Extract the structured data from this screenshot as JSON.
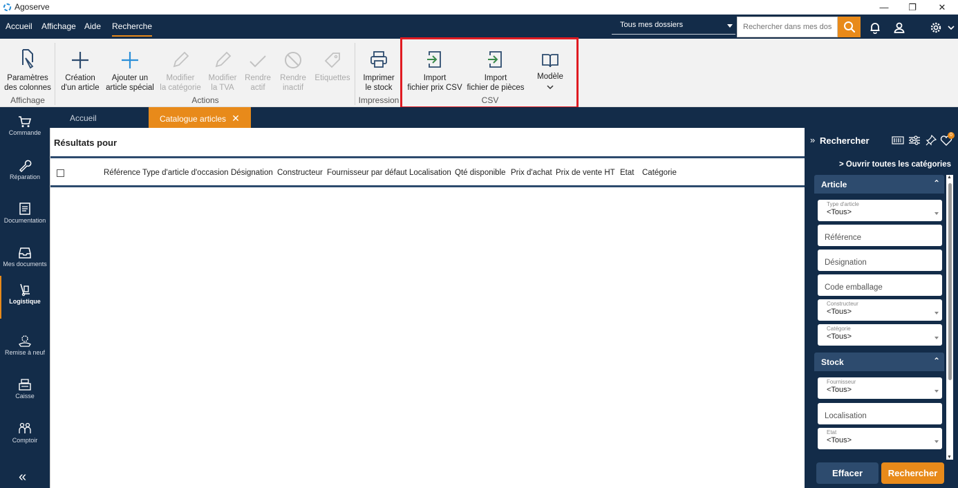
{
  "window": {
    "title": "Agoserve",
    "min": "—",
    "restore": "❐",
    "close": "✕"
  },
  "menu": {
    "items": [
      "Accueil",
      "Affichage",
      "Aide",
      "Recherche"
    ],
    "active": "Recherche"
  },
  "header": {
    "dossier_select": "Tous mes dossiers",
    "search_placeholder": "Rechercher dans mes dossiers"
  },
  "ribbon": {
    "buttons": {
      "col_params": [
        "Paramètres",
        "des colonnes"
      ],
      "create_article": [
        "Création",
        "d'un article"
      ],
      "add_special": [
        "Ajouter un",
        "article spécial"
      ],
      "edit_category": [
        "Modifier",
        "la catégorie"
      ],
      "edit_tva": [
        "Modifier",
        "la TVA"
      ],
      "make_active": [
        "Rendre",
        "actif"
      ],
      "make_inactive": [
        "Rendre",
        "inactif"
      ],
      "labels": [
        "Etiquettes"
      ],
      "print_stock": [
        "Imprimer",
        "le stock"
      ],
      "import_price_csv": [
        "Import",
        "fichier prix CSV"
      ],
      "import_parts": [
        "Import",
        "fichier de pièces"
      ],
      "model": [
        "Modèle"
      ]
    },
    "groups": {
      "affichage": "Affichage",
      "actions": "Actions",
      "impression": "Impression",
      "csv": "CSV"
    }
  },
  "nav": {
    "items": [
      "Commande",
      "Réparation",
      "Documentation",
      "Mes documents",
      "Logistique",
      "Remise à neuf",
      "Caisse",
      "Comptoir"
    ],
    "active": "Logistique",
    "collapse": "«"
  },
  "tabs": [
    "Accueil",
    "Catalogue articles"
  ],
  "tab_close": "✕",
  "main": {
    "title": "Résultats pour",
    "columns": [
      "Référence",
      "Type d'article d'occasion",
      "Désignation",
      "Constructeur",
      "Fournisseur par défaut",
      "Localisation",
      "Qté disponible",
      "Prix d'achat",
      "Prix de vente HT",
      "Etat",
      "Catégorie"
    ]
  },
  "search_panel": {
    "title": "Rechercher",
    "collapse": "»",
    "badge": "0",
    "open_all": "> Ouvrir toutes les catégories",
    "sections": {
      "article": "Article",
      "stock": "Stock",
      "collapse_icon": "⌃"
    },
    "fields": {
      "type_label": "Type d'article",
      "type_value": "<Tous>",
      "reference": "Référence",
      "designation": "Désignation",
      "code_emballage": "Code emballage",
      "constructeur_label": "Constructeur",
      "constructeur_value": "<Tous>",
      "categorie_label": "Catégorie",
      "categorie_value": "<Tous>",
      "fournisseur_label": "Fournisseur",
      "fournisseur_value": "<Tous>",
      "localisation": "Localisation",
      "etat_label": "Etat",
      "etat_value": "<Tous>"
    },
    "scroll_up": "▲",
    "scroll_down": "▼",
    "clear_label": "Effacer",
    "search_label": "Rechercher"
  }
}
